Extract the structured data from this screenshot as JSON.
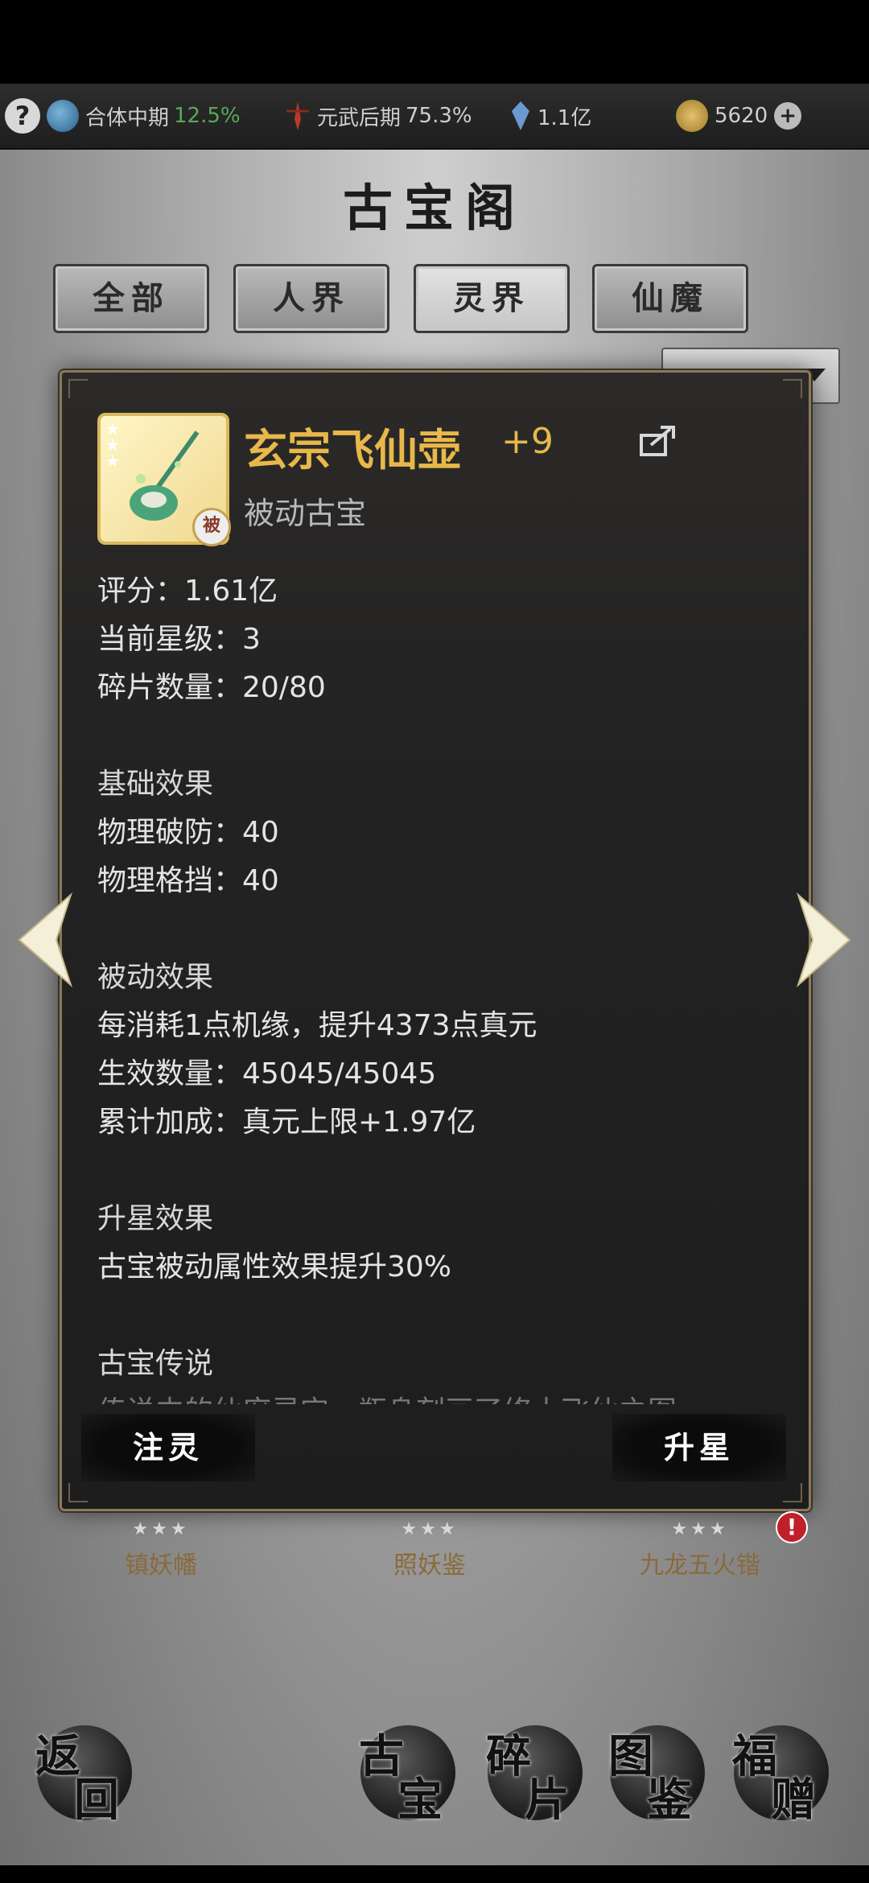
{
  "status": {
    "help": "?",
    "realm1_label": "合体中期",
    "realm1_value": "12.5%",
    "realm2_label": "元武后期",
    "realm2_value": "75.3%",
    "crystal": "1.1亿",
    "currency": "5620",
    "add": "+"
  },
  "title": "古宝阁",
  "tabs": [
    "全部",
    "人界",
    "灵界",
    "仙魔"
  ],
  "active_tab": "灵界",
  "item": {
    "name": "玄宗飞仙壶",
    "plus": "+9",
    "type": "被动古宝",
    "badge": "被",
    "stars": [
      "★",
      "★",
      "★"
    ],
    "score_label": "评分：1.61亿",
    "star_level_label": "当前星级：3",
    "fragments_label": "碎片数量：20/80",
    "base_title": "基础效果",
    "base1": "物理破防：40",
    "base2": "物理格挡：40",
    "passive_title": "被动效果",
    "passive1": "每消耗1点机缘，提升4373点真元",
    "passive2": "生效数量：45045/45045",
    "passive3": "累计加成：真元上限+1.97亿",
    "upgrade_title": "升星效果",
    "upgrade1": "古宝被动属性效果提升30%",
    "legend_title": "古宝传说",
    "legend_text": "传说中的仙府灵宝，瓶身刻画了修士飞仙之图"
  },
  "buttons": {
    "infuse": "注灵",
    "star_up": "升星"
  },
  "shelf": [
    {
      "label": "镇妖幡",
      "stars": "★★★"
    },
    {
      "label": "照妖鉴",
      "stars": "★★★"
    },
    {
      "label": "九龙五火锴",
      "stars": "★★★"
    }
  ],
  "alert": "!",
  "nav": {
    "back": [
      "返",
      "回"
    ],
    "treasure": [
      "古",
      "宝"
    ],
    "fragments": [
      "碎",
      "片"
    ],
    "catalog": [
      "图",
      "鉴"
    ],
    "gift": [
      "福",
      "赠"
    ]
  },
  "colors": {
    "gold": "#e8b84a",
    "green": "#58a85a",
    "panel": "#1d1d1d",
    "alert": "#c0202a"
  }
}
